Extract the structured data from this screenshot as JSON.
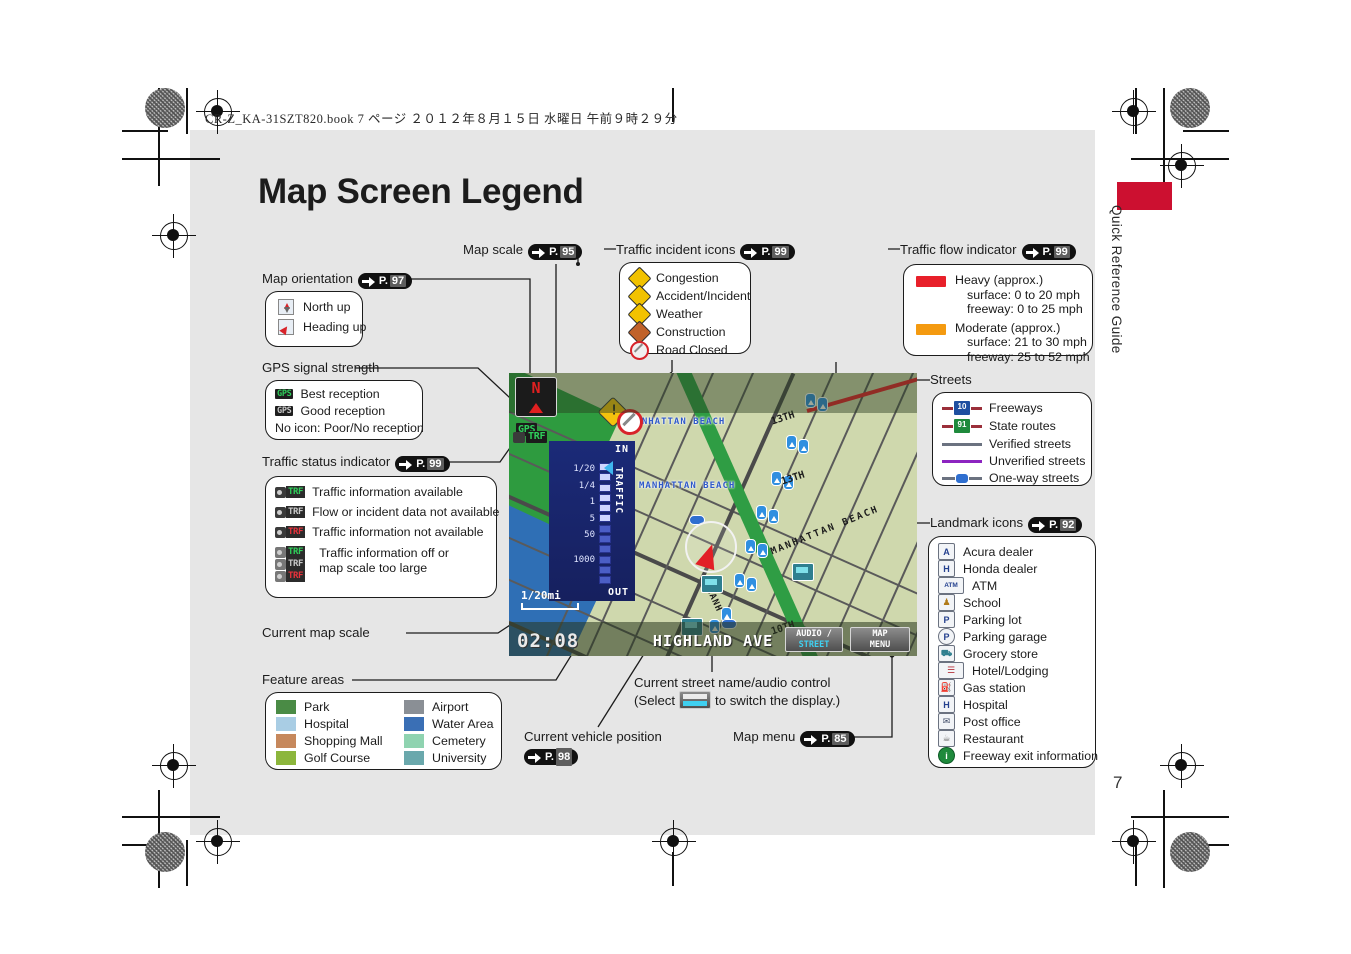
{
  "header": {
    "printer_line": "CR-Z_KA-31SZT820.book   7 ページ   ２０１２年８月１５日   水曜日   午前９時２９分"
  },
  "page": {
    "title": "Map Screen Legend",
    "side_tab": "Quick Reference Guide",
    "page_number": "7",
    "accent_color": "#cc1030"
  },
  "callouts": {
    "map_orientation": {
      "label": "Map orientation",
      "page_ref": "97",
      "items": [
        {
          "label": "North up"
        },
        {
          "label": "Heading up"
        }
      ]
    },
    "gps_signal": {
      "label": "GPS signal strength",
      "items": [
        {
          "icon": "GPS",
          "label": "Best reception",
          "color": "#2fcf5a"
        },
        {
          "icon": "GPS",
          "label": "Good reception",
          "color": "#bfbfbf"
        },
        {
          "icon": "",
          "label": "No icon: Poor/No reception",
          "color": ""
        }
      ]
    },
    "traffic_status": {
      "label": "Traffic status indicator",
      "page_ref": "99",
      "items": [
        {
          "icon": "TRF",
          "label": "Traffic information available",
          "color": "#2fcf5a",
          "camera": true
        },
        {
          "icon": "TRF",
          "label": "Flow or incident data not available",
          "color": "#bfbfbf",
          "camera": true
        },
        {
          "icon": "TRF",
          "label": "Traffic information not available",
          "color": "#e8323c",
          "camera": true
        },
        {
          "icon": "TRF",
          "label": "Traffic information off or map scale too large",
          "color": "#2fcf5a",
          "camera": false
        }
      ],
      "extra_icons": [
        {
          "icon": "TRF",
          "color": "#2fcf5a"
        },
        {
          "icon": "TRF",
          "color": "#bfbfbf"
        },
        {
          "icon": "TRF",
          "color": "#e8323c"
        }
      ]
    },
    "current_map_scale": {
      "label": "Current map scale"
    },
    "feature_areas": {
      "label": "Feature areas",
      "left": [
        {
          "label": "Park",
          "color": "#4a8b45"
        },
        {
          "label": "Hospital",
          "color": "#a9cde4"
        },
        {
          "label": "Shopping Mall",
          "color": "#c6885c"
        },
        {
          "label": "Golf Course",
          "color": "#8cb63c"
        }
      ],
      "right": [
        {
          "label": "Airport",
          "color": "#8a8f95"
        },
        {
          "label": "Water Area",
          "color": "#3a6fb5"
        },
        {
          "label": "Cemetery",
          "color": "#8fd3b0"
        },
        {
          "label": "University",
          "color": "#6aa8ac"
        }
      ]
    },
    "map_scale": {
      "label": "Map scale",
      "page_ref": "95"
    },
    "traffic_incident_icons": {
      "label": "Traffic incident icons",
      "page_ref": "99",
      "items": [
        {
          "label": "Congestion",
          "color": "#f2c200"
        },
        {
          "label": "Accident/Incident",
          "color": "#f2c200"
        },
        {
          "label": "Weather",
          "color": "#f2c200"
        },
        {
          "label": "Construction",
          "color": "#c0622a"
        },
        {
          "label": "Road Closed",
          "color": "#d8232a"
        }
      ]
    },
    "traffic_flow_indicator": {
      "label": "Traffic flow indicator",
      "page_ref": "99",
      "items": [
        {
          "title": "Heavy (approx.)",
          "color": "#e8202a",
          "lines": [
            "surface: 0 to 20 mph",
            "freeway: 0 to 25 mph"
          ]
        },
        {
          "title": "Moderate (approx.)",
          "color": "#f49a10",
          "lines": [
            "surface: 21 to 30 mph",
            "freeway: 25 to 52 mph"
          ]
        }
      ]
    },
    "streets": {
      "label": "Streets",
      "items": [
        {
          "label": "Freeways",
          "shield": "10",
          "shield_color": "#1f4fa0",
          "line_color": "#9b2f3a"
        },
        {
          "label": "State routes",
          "shield": "91",
          "shield_color": "#1f8a3c",
          "line_color": "#9b2f3a"
        },
        {
          "label": "Verified streets",
          "shield": "",
          "line_color": "#6b7280"
        },
        {
          "label": "Unverified streets",
          "shield": "",
          "line_color": "#8c24c0"
        },
        {
          "label": "One-way streets",
          "shield": "",
          "line_color": "#6b7280"
        }
      ]
    },
    "landmark_icons": {
      "label": "Landmark icons",
      "page_ref": "92",
      "items": [
        {
          "label": "Acura dealer",
          "glyph": "A"
        },
        {
          "label": "Honda dealer",
          "glyph": "H"
        },
        {
          "label": "ATM",
          "glyph": "ATM"
        },
        {
          "label": "School",
          "glyph": "♟"
        },
        {
          "label": "Parking lot",
          "glyph": "P"
        },
        {
          "label": "Parking garage",
          "glyph": "P"
        },
        {
          "label": "Grocery store",
          "glyph": "⛟"
        },
        {
          "label": "Hotel/Lodging",
          "glyph": "☰"
        },
        {
          "label": "Gas station",
          "glyph": "⛽"
        },
        {
          "label": "Hospital",
          "glyph": "H"
        },
        {
          "label": "Post office",
          "glyph": "✉"
        },
        {
          "label": "Restaurant",
          "glyph": "☕"
        },
        {
          "label": "Freeway exit information",
          "glyph": "i"
        }
      ]
    },
    "streets_label": {
      "label": "Streets"
    },
    "current_street": {
      "line1": "Current street name/audio control",
      "line2a": "(Select",
      "line2b": "to switch the display.)"
    },
    "current_vehicle_position": {
      "label": "Current vehicle position",
      "page_ref": "98"
    },
    "map_menu": {
      "label": "Map menu",
      "page_ref": "85"
    }
  },
  "nav_screen": {
    "compass_letter": "N",
    "gps_badge": "GPS",
    "trf_badge": "TRF",
    "scale_in": "IN",
    "scale_out": "OUT",
    "scale_traffic_word": "TRAFFIC",
    "scale_ticks": [
      "1/20",
      "1/4",
      "1",
      "5",
      "50",
      "1000"
    ],
    "current_scale": "1/20mi",
    "clock": "02:08",
    "street_name": "HIGHLAND AVE",
    "button_audio_line1": "AUDIO /",
    "button_audio_line2": "STREET",
    "button_map_line1": "MAP",
    "button_map_line2": "MENU",
    "map_labels": [
      "MANHATTAN  BEACH",
      "MANHATTAN  BEACH"
    ],
    "street_labels": [
      "13TH",
      "13TH",
      "MANHATTAN BEACH",
      "MANH",
      "10TH"
    ]
  }
}
